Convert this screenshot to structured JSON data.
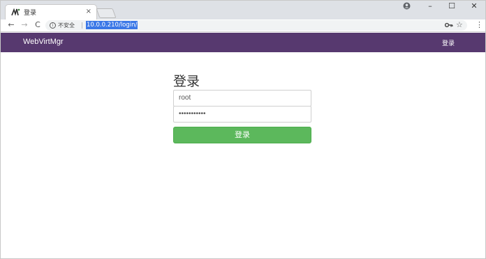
{
  "browser": {
    "tab_title": "登录",
    "tab_close": "×",
    "address": {
      "security_label": "不安全",
      "url": "10.0.0.210/login/"
    },
    "nav": {
      "back": "←",
      "forward": "→",
      "reload": "C"
    },
    "window_controls": {
      "minimize": "–",
      "maximize": "☐",
      "close": "✕"
    },
    "star": "☆",
    "menu": "⋮"
  },
  "navbar": {
    "brand": "WebVirtMgr",
    "login_link": "登录",
    "background": "#57396f"
  },
  "login_form": {
    "title": "登录",
    "username_value": "root",
    "password_mask": "•••••••••••",
    "submit_label": "登录",
    "submit_color": "#5cb85c"
  }
}
